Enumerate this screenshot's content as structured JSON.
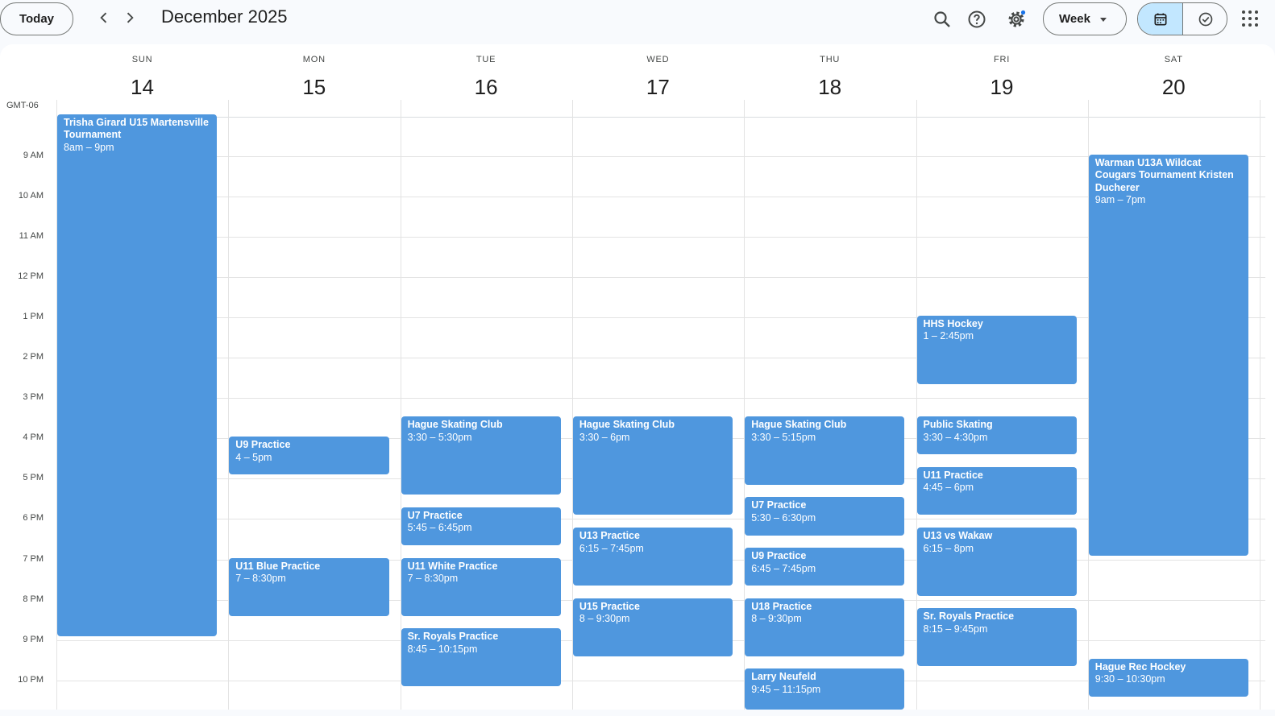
{
  "toolbar": {
    "today_label": "Today",
    "month_title": "December 2025",
    "view_label": "Week",
    "icons": [
      "chevron-left-icon",
      "chevron-right-icon",
      "search-icon",
      "help-icon",
      "settings-icon",
      "calendar-icon",
      "tasks-icon",
      "apps-icon"
    ]
  },
  "timezone": "GMT-06",
  "days": [
    {
      "dow": "SUN",
      "num": "14"
    },
    {
      "dow": "MON",
      "num": "15"
    },
    {
      "dow": "TUE",
      "num": "16"
    },
    {
      "dow": "WED",
      "num": "17"
    },
    {
      "dow": "THU",
      "num": "18"
    },
    {
      "dow": "FRI",
      "num": "19"
    },
    {
      "dow": "SAT",
      "num": "20"
    }
  ],
  "hours": [
    "9 AM",
    "10 AM",
    "11 AM",
    "12 PM",
    "1 PM",
    "2 PM",
    "3 PM",
    "4 PM",
    "5 PM",
    "6 PM",
    "7 PM",
    "8 PM",
    "9 PM",
    "10 PM"
  ],
  "event_color": "#4f97de",
  "events": [
    {
      "day": 0,
      "start": 8,
      "end": 21,
      "title": "Trisha Girard U15 Martensville Tournament",
      "time": "8am – 9pm"
    },
    {
      "day": 1,
      "start": 16,
      "end": 17,
      "title": "U9 Practice",
      "time": "4 – 5pm"
    },
    {
      "day": 1,
      "start": 19,
      "end": 20.5,
      "title": "U11 Blue Practice",
      "time": "7 – 8:30pm"
    },
    {
      "day": 2,
      "start": 15.5,
      "end": 17.5,
      "title": "Hague Skating Club",
      "time": "3:30 – 5:30pm"
    },
    {
      "day": 2,
      "start": 17.75,
      "end": 18.75,
      "title": "U7 Practice",
      "time": "5:45 – 6:45pm"
    },
    {
      "day": 2,
      "start": 19,
      "end": 20.5,
      "title": "U11 White Practice",
      "time": "7 – 8:30pm"
    },
    {
      "day": 2,
      "start": 20.75,
      "end": 22.25,
      "title": "Sr. Royals Practice",
      "time": "8:45 – 10:15pm"
    },
    {
      "day": 3,
      "start": 15.5,
      "end": 18,
      "title": "Hague Skating Club",
      "time": "3:30 – 6pm"
    },
    {
      "day": 3,
      "start": 18.25,
      "end": 19.75,
      "title": "U13 Practice",
      "time": "6:15 – 7:45pm"
    },
    {
      "day": 3,
      "start": 20,
      "end": 21.5,
      "title": "U15 Practice",
      "time": "8 – 9:30pm"
    },
    {
      "day": 4,
      "start": 15.5,
      "end": 17.25,
      "title": "Hague Skating Club",
      "time": "3:30 – 5:15pm"
    },
    {
      "day": 4,
      "start": 17.5,
      "end": 18.5,
      "title": "U7 Practice",
      "time": "5:30 – 6:30pm"
    },
    {
      "day": 4,
      "start": 18.75,
      "end": 19.75,
      "title": "U9 Practice",
      "time": "6:45 – 7:45pm"
    },
    {
      "day": 4,
      "start": 20,
      "end": 21.5,
      "title": "U18 Practice",
      "time": "8 – 9:30pm"
    },
    {
      "day": 4,
      "start": 21.75,
      "end": 23.25,
      "title": "Larry Neufeld",
      "time": "9:45 – 11:15pm"
    },
    {
      "day": 5,
      "start": 13,
      "end": 14.75,
      "title": "HHS Hockey",
      "time": "1 – 2:45pm"
    },
    {
      "day": 5,
      "start": 15.5,
      "end": 16.5,
      "title": "Public Skating",
      "time": "3:30 – 4:30pm"
    },
    {
      "day": 5,
      "start": 16.75,
      "end": 18,
      "title": "U11 Practice",
      "time": "4:45 – 6pm"
    },
    {
      "day": 5,
      "start": 18.25,
      "end": 20,
      "title": "U13 vs Wakaw",
      "time": "6:15 – 8pm"
    },
    {
      "day": 5,
      "start": 20.25,
      "end": 21.75,
      "title": "Sr. Royals Practice",
      "time": "8:15 – 9:45pm"
    },
    {
      "day": 6,
      "start": 9,
      "end": 19,
      "title": "Warman U13A Wildcat Cougars Tournament Kristen Ducherer",
      "time": "9am – 7pm"
    },
    {
      "day": 6,
      "start": 21.5,
      "end": 22.5,
      "title": "Hague Rec Hockey",
      "time": "9:30 – 10:30pm"
    }
  ]
}
